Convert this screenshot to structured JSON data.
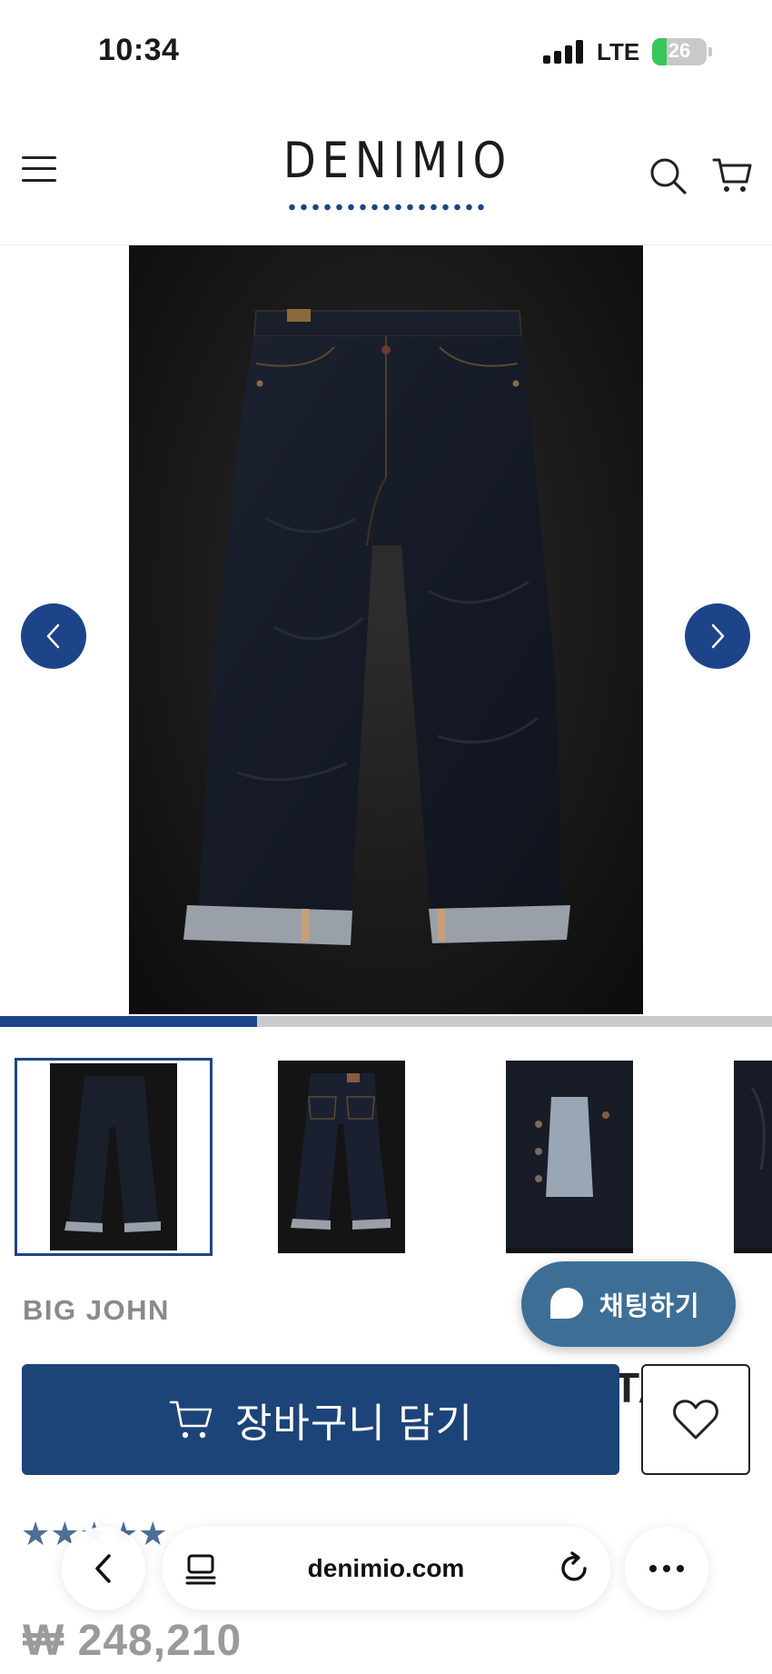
{
  "status_bar": {
    "time": "10:34",
    "network": "LTE",
    "battery": "26",
    "battery_level": 0.26,
    "icons": [
      "signal-bars-icon",
      "battery-icon"
    ]
  },
  "header": {
    "logo_text": "DENIMIO",
    "icons": [
      "hamburger-menu-icon",
      "search-icon",
      "cart-icon"
    ]
  },
  "gallery": {
    "image_index": 1,
    "image_count": 4,
    "progress": 0.333,
    "icons": [
      "chevron-left-icon",
      "chevron-right-icon"
    ]
  },
  "thumbnails": [
    {
      "label": "front view",
      "active": true
    },
    {
      "label": "back view",
      "active": false
    },
    {
      "label": "fly detail",
      "active": false
    },
    {
      "label": "side detail",
      "active": false
    }
  ],
  "product": {
    "brand": "BIG JOHN",
    "title_fragment": "TA",
    "rating_stars": 5,
    "price": "₩ 248,210"
  },
  "actions": {
    "chat_label": "채팅하기",
    "add_to_cart_label": "장바구니 담기",
    "icons": [
      "chat-bubble-icon",
      "cart-icon",
      "heart-icon"
    ]
  },
  "browser": {
    "address": "denimio.com",
    "icons": [
      "back-icon",
      "reader-icon",
      "reload-icon",
      "more-icon"
    ]
  },
  "colors": {
    "brand_navy": "#1d4488",
    "button_navy": "#1d4478",
    "chat_blue": "#3d6f96",
    "star_blue": "#4d6e98",
    "battery_green": "#38c759"
  }
}
